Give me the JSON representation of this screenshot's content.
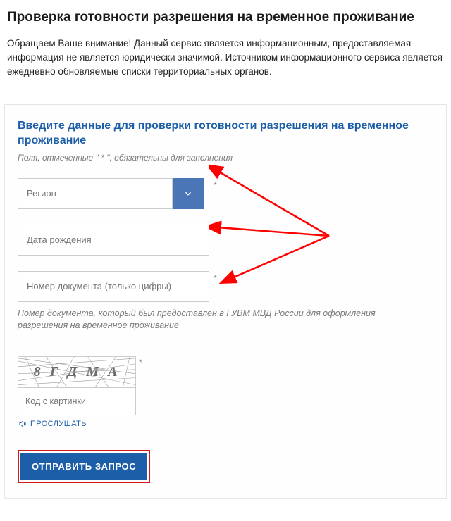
{
  "title": "Проверка готовности разрешения на временное проживание",
  "intro": "Обращаем Ваше внимание! Данный сервис является информационным, предоставляемая информация не является юридически значимой. Источником информационного сервиса является ежедневно обновляемые списки территориальных органов.",
  "form": {
    "heading": "Введите данные для проверки готовности разрешения на временное проживание",
    "required_note_before": "Поля, отмеченные ",
    "required_note_star": "\" * \"",
    "required_note_after": ", обязательны для заполнения",
    "region": {
      "placeholder": "Регион"
    },
    "dob": {
      "placeholder": "Дата рождения"
    },
    "docnum": {
      "placeholder": "Номер документа (только цифры)",
      "help": "Номер документа, который был предоставлен в ГУВМ МВД России для оформления разрешения на временное проживание"
    },
    "captcha": {
      "text": "8 Г Д М А",
      "placeholder": "Код с картинки",
      "listen": "ПРОСЛУШАТЬ"
    },
    "submit": "ОТПРАВИТЬ ЗАПРОС"
  },
  "colors": {
    "accent": "#1d5ea8",
    "dropdown": "#4a76b8",
    "annotation": "#ff0000"
  }
}
